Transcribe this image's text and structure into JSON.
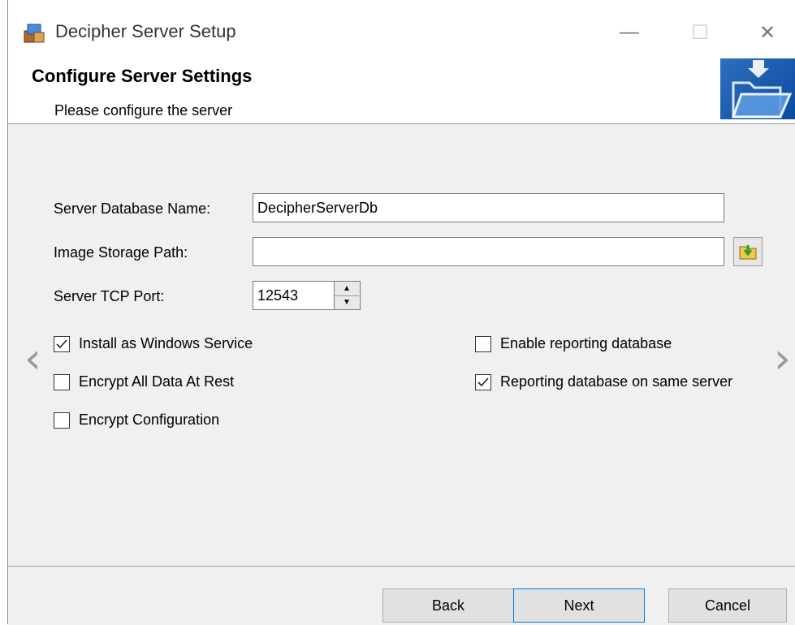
{
  "window": {
    "title": "Decipher Server Setup",
    "minimize_glyph": "—",
    "maximize_glyph": "☐",
    "close_glyph": "✕"
  },
  "header": {
    "title": "Configure Server Settings",
    "subtitle": "Please configure the server",
    "banner_icon": "folder-download-icon"
  },
  "form": {
    "db_name": {
      "label": "Server Database Name:",
      "value": "DecipherServerDb"
    },
    "image_path": {
      "label": "Image Storage Path:",
      "value": "",
      "browse_icon": "folder-browse-icon"
    },
    "tcp_port": {
      "label": "Server TCP Port:",
      "value": "12543"
    }
  },
  "checkboxes": {
    "install_service": {
      "label": "Install as Windows Service",
      "checked": true
    },
    "encrypt_data": {
      "label": "Encrypt All Data At Rest",
      "checked": false
    },
    "encrypt_config": {
      "label": "Encrypt Configuration",
      "checked": false
    },
    "enable_reporting": {
      "label": "Enable reporting database",
      "checked": false
    },
    "reporting_same_server": {
      "label": "Reporting database on same server",
      "checked": true
    }
  },
  "nav": {
    "prev_glyph": "‹",
    "next_glyph": "›"
  },
  "footer": {
    "back_label": "Back",
    "next_label": "Next",
    "cancel_label": "Cancel"
  }
}
